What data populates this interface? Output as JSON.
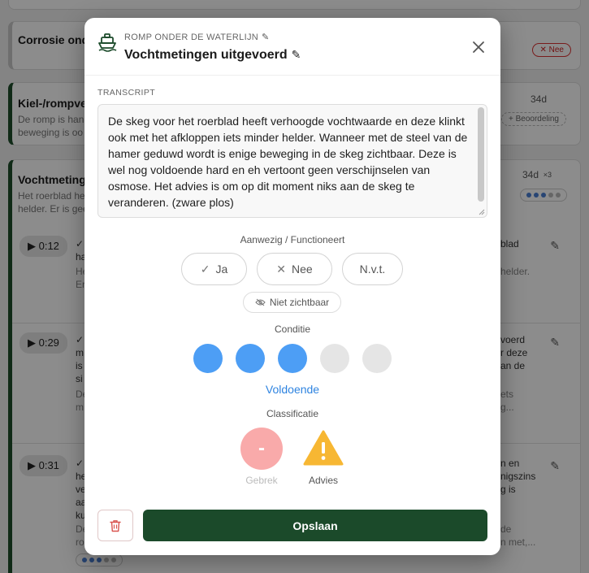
{
  "background": {
    "cards": [
      {
        "title": "Corrosie ond",
        "badge": "Nee"
      },
      {
        "title": "Kiel-/rompve",
        "sub1": "De romp is han",
        "sub2": "beweging is oo",
        "meta": "34d",
        "pill": "+ Beoordeling"
      },
      {
        "title": "Vochtmeting",
        "sub1": "Het roerblad he",
        "sub2": "helder. Er is gee",
        "meta": "34d",
        "meta2": "×3"
      }
    ],
    "entries": [
      {
        "time": "0:12",
        "l1": "✓",
        "l2": "ha",
        "l3": "He",
        "l4": "Er",
        "r1": "blad",
        "r2": "helder."
      },
      {
        "time": "0:29",
        "l1": "✓",
        "l2": "m",
        "l3": "is",
        "l4": "si",
        "l5": "De",
        "l6": "m",
        "r1": "voerd",
        "r2": "r deze",
        "r3": "an de",
        "r4": "ets",
        "r5": "g..."
      },
      {
        "time": "0:31",
        "l1": "✓",
        "l2": "he",
        "l3": "ve",
        "l4": "aa",
        "l5": "ku",
        "l6": "De",
        "l7": "ro",
        "r1": "n en",
        "r2": "nigszins",
        "r3": "g is",
        "r4": "de",
        "r5": "n met,..."
      }
    ]
  },
  "modal": {
    "category": "ROMP ONDER DE WATERLIJN",
    "title": "Vochtmetingen uitgevoerd",
    "transcript_label": "TRANSCRIPT",
    "transcript": "De skeg voor het roerblad heeft verhoogde vochtwaarde en deze klinkt ook met het afkloppen iets minder helder. Wanneer met de steel van de hamer geduwd wordt is enige beweging in de skeg zichtbaar. Deze is wel nog voldoende hard en eh vertoont geen verschijnselen van osmose. Het advies is om op dit moment niks aan de skeg te veranderen. (zware plos)",
    "presence_label": "Aanwezig / Functioneert",
    "choices": {
      "yes": "Ja",
      "no": "Nee",
      "na": "N.v.t."
    },
    "not_visible": "Niet zichtbaar",
    "condition_label": "Conditie",
    "condition_level": 3,
    "condition_max": 5,
    "condition_value": "Voldoende",
    "classification_label": "Classificatie",
    "classifications": {
      "defect_symbol": "-",
      "defect": "Gebrek",
      "advice": "Advies"
    },
    "save_label": "Opslaan"
  },
  "colors": {
    "accent_green": "#1b4a2a",
    "condition_blue": "#4d9ef5",
    "defect_pink": "#f9aaaa",
    "advice_amber": "#f7b733",
    "delete_red": "#d9534f"
  },
  "icons": [
    "ship-icon",
    "pencil-icon",
    "close-icon",
    "check-icon",
    "x-icon",
    "eye-off-icon",
    "warning-icon",
    "trash-icon"
  ]
}
